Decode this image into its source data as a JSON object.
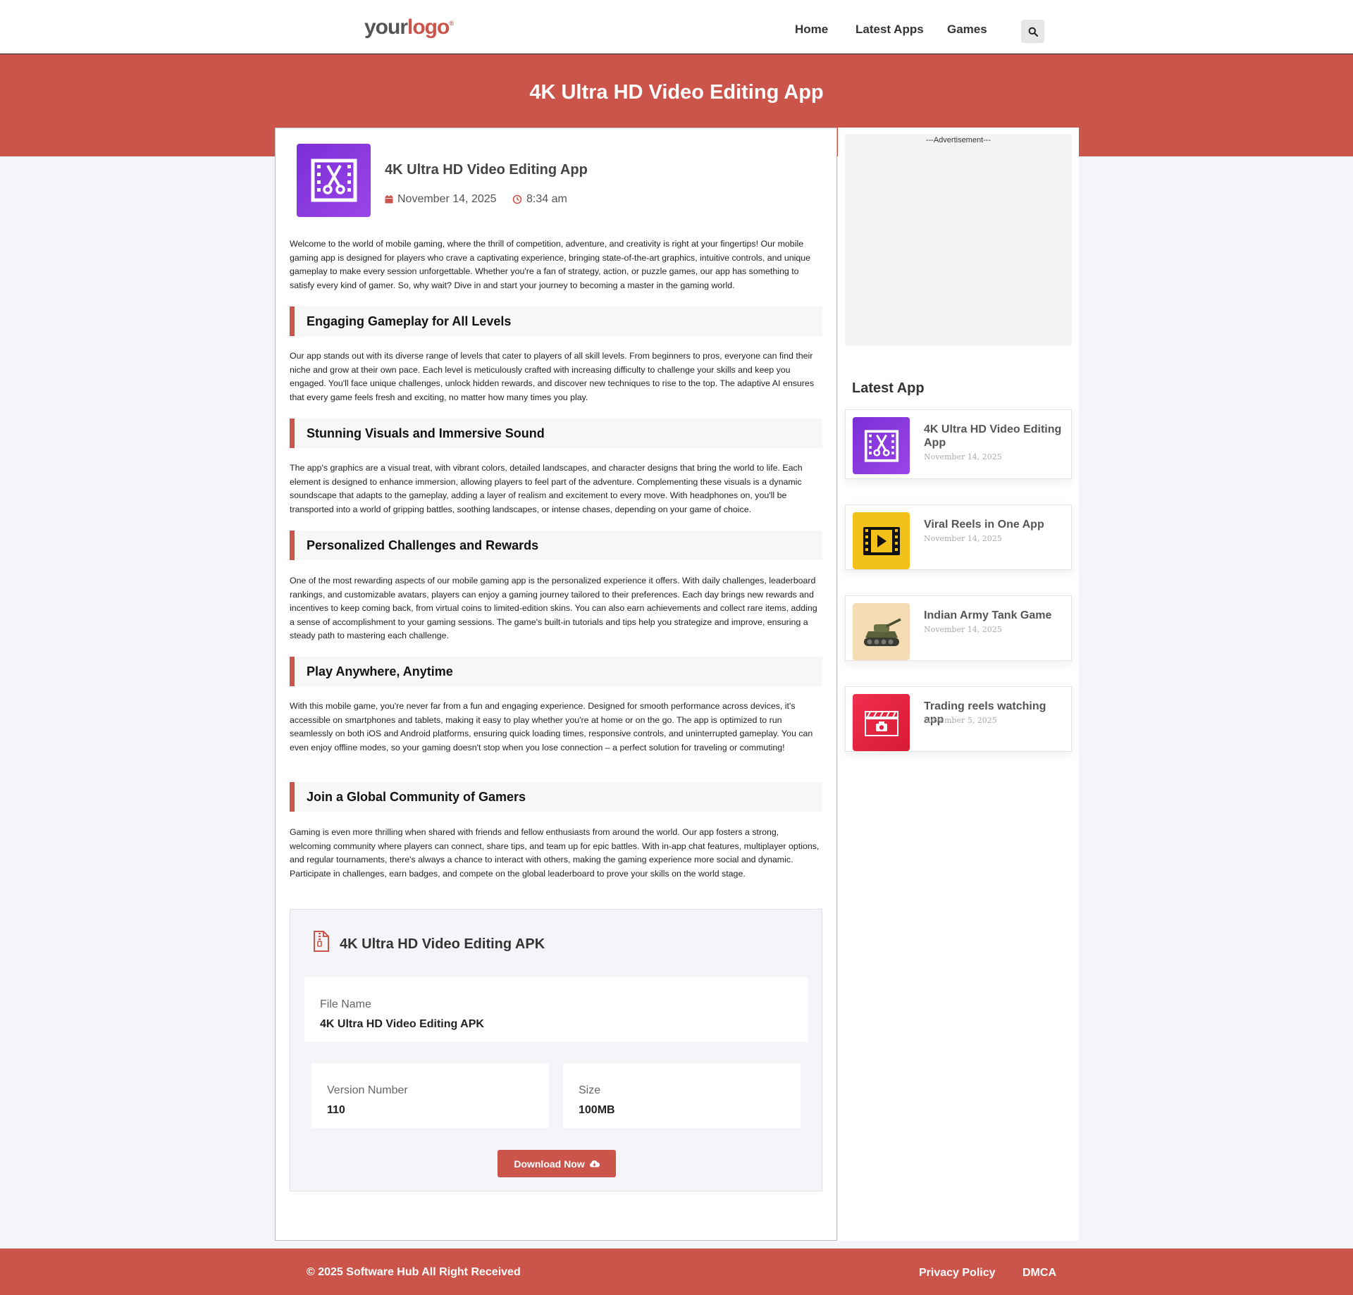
{
  "header": {
    "logo_part1": "your",
    "logo_part2": "logo",
    "logo_mark": "®",
    "nav": [
      "Home",
      "Latest Apps",
      "Games"
    ],
    "search_icon": "search-icon"
  },
  "hero": {
    "title": "4K Ultra HD Video Editing App"
  },
  "post": {
    "title": "4K Ultra HD Video Editing App",
    "date": "November 14, 2025",
    "time": "8:34 am",
    "intro": "Welcome to the world of mobile gaming, where the thrill of competition, adventure, and creativity is right at your fingertips! Our mobile gaming app is designed for players who crave a captivating experience, bringing state-of-the-art graphics, intuitive controls, and unique gameplay to make every session unforgettable. Whether you're a fan of strategy, action, or puzzle games, our app has something to satisfy every kind of gamer. So, why wait? Dive in and start your journey to becoming a master in the gaming world.",
    "sections": [
      {
        "heading": "Engaging Gameplay for All Levels",
        "body": "Our app stands out with its diverse range of levels that cater to players of all skill levels. From beginners to pros, everyone can find their niche and grow at their own pace. Each level is meticulously crafted with increasing difficulty to challenge your skills and keep you engaged. You'll face unique challenges, unlock hidden rewards, and discover new techniques to rise to the top. The adaptive AI ensures that every game feels fresh and exciting, no matter how many times you play."
      },
      {
        "heading": "Stunning Visuals and Immersive Sound",
        "body": "The app's graphics are a visual treat, with vibrant colors, detailed landscapes, and character designs that bring the world to life. Each element is designed to enhance immersion, allowing players to feel part of the adventure. Complementing these visuals is a dynamic soundscape that adapts to the gameplay, adding a layer of realism and excitement to every move. With headphones on, you'll be transported into a world of gripping battles, soothing landscapes, or intense chases, depending on your game of choice."
      },
      {
        "heading": "Personalized Challenges and Rewards",
        "body": "One of the most rewarding aspects of our mobile gaming app is the personalized experience it offers. With daily challenges, leaderboard rankings, and customizable avatars, players can enjoy a gaming journey tailored to their preferences. Each day brings new rewards and incentives to keep coming back, from virtual coins to limited-edition skins. You can also earn achievements and collect rare items, adding a sense of accomplishment to your gaming sessions. The game's built-in tutorials and tips help you strategize and improve, ensuring a steady path to mastering each challenge."
      },
      {
        "heading": "Play Anywhere, Anytime",
        "body": "With this mobile game, you're never far from a fun and engaging experience. Designed for smooth performance across devices, it's accessible on smartphones and tablets, making it easy to play whether you're at home or on the go. The app is optimized to run seamlessly on both iOS and Android platforms, ensuring quick loading times, responsive controls, and uninterrupted gameplay. You can even enjoy offline modes, so your gaming doesn't stop when you lose connection – a perfect solution for traveling or commuting!"
      },
      {
        "heading": "Join a Global Community of Gamers",
        "body": "Gaming is even more thrilling when shared with friends and fellow enthusiasts from around the world. Our app fosters a strong, welcoming community where players can connect, share tips, and team up for epic battles. With in-app chat features, multiplayer options, and regular tournaments, there's always a chance to interact with others, making the gaming experience more social and dynamic. Participate in challenges, earn badges, and compete on the global leaderboard to prove your skills on the world stage."
      }
    ]
  },
  "apk": {
    "title": "4K Ultra HD Video Editing APK",
    "file_name_label": "File Name",
    "file_name": "4K Ultra HD Video Editing APK",
    "version_label": "Version Number",
    "version": "110",
    "size_label": "Size",
    "size": "100MB",
    "download_label": "Download Now"
  },
  "sidebar": {
    "ad_label": "---Advertisement---",
    "heading": "Latest App",
    "items": [
      {
        "title": "4K Ultra HD Video Editing App",
        "date": "November 14, 2025",
        "icon": "video-edit-icon"
      },
      {
        "title": "Viral Reels in One App",
        "date": "November 14, 2025",
        "icon": "film-play-icon"
      },
      {
        "title": "Indian Army Tank Game",
        "date": "November 14, 2025",
        "icon": "tank-icon"
      },
      {
        "title": "Trading reels watching app",
        "date": "November 5, 2025",
        "icon": "clapper-camera-icon"
      }
    ]
  },
  "footer": {
    "copyright": "© 2025 Software Hub All Right Received",
    "links": [
      "Privacy Policy",
      "DMCA"
    ]
  },
  "colors": {
    "accent": "#cc554b",
    "app_purple": "#7b2fd6",
    "reels_yellow": "#f2c21b",
    "trading_red": "#e8223e"
  }
}
